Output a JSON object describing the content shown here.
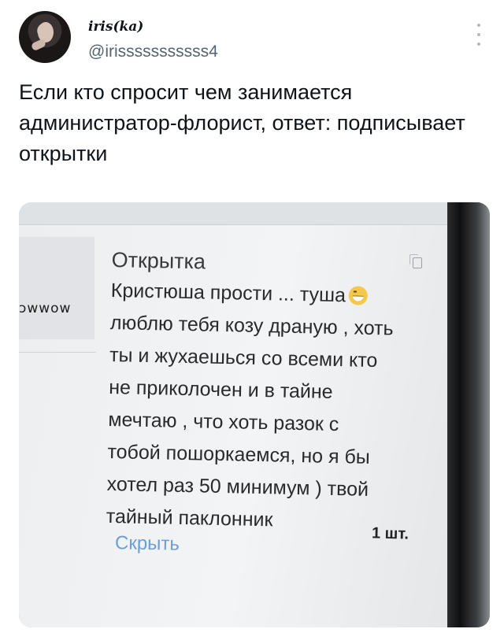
{
  "tweet": {
    "display_name": "iris(ka)",
    "handle": "@irisssssssssss4",
    "text": "Если кто спросит чем занимается администратор-флорист, ответ: подписывает открытки"
  },
  "photo": {
    "partial_left_text": "ɔwwow",
    "card": {
      "title": "Открытка",
      "lines": [
        "Кристюша прости ... туша",
        "люблю тебя козу драную , хоть",
        "ты и жухаешься со всеми кто",
        "не приколочен и в тайне",
        "мечтаю , что хоть разок с",
        "тобой пошоркаемся, но я бы",
        "хотел раз 50 минимум ) твой",
        "тайный паклонник"
      ],
      "emoji": "grinning-face-icon",
      "hide_label": "Скрыть",
      "quantity": "1 шт."
    }
  },
  "colors": {
    "handle": "#536471",
    "link": "#6b9fd6",
    "text": "#0f1419"
  }
}
